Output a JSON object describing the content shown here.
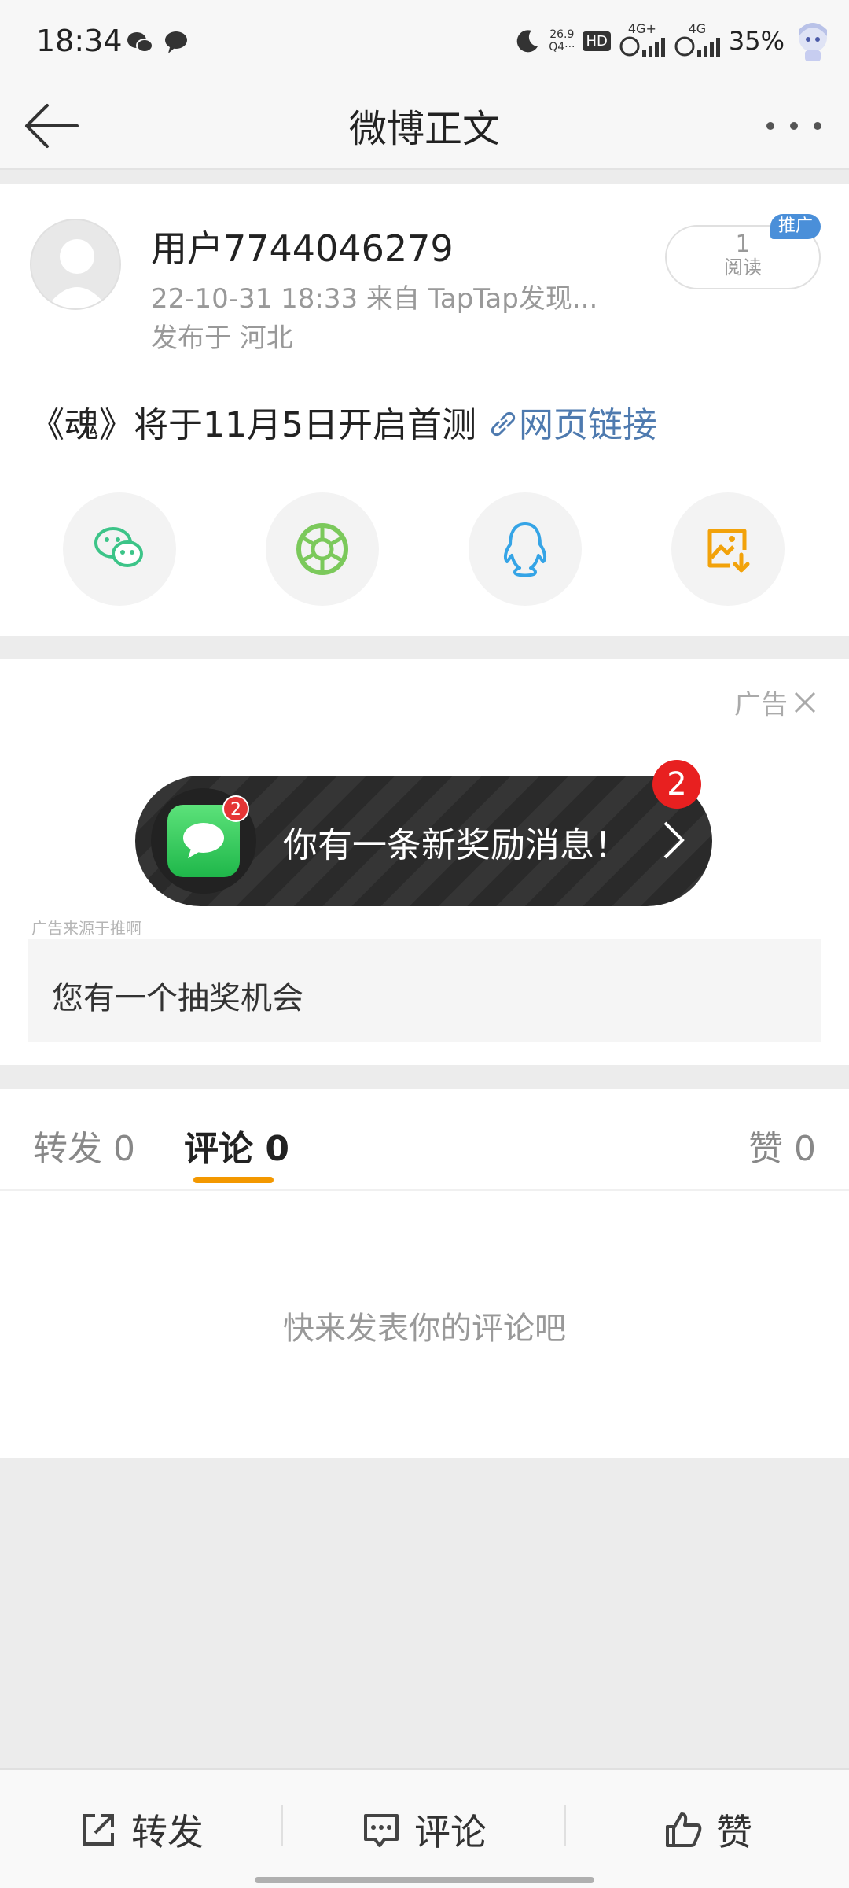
{
  "status_bar": {
    "time": "18:34",
    "speed_top": "26.9",
    "speed_bottom": "Q4···",
    "hd_label": "HD",
    "net1": "4G+",
    "net2": "4G",
    "battery": "35%"
  },
  "header": {
    "title": "微博正文"
  },
  "post": {
    "username": "用户7744046279",
    "meta": "22-10-31 18:33   来自 TapTap发现...",
    "location": "发布于 河北",
    "read_count": "1",
    "read_label": "阅读",
    "promo_badge": "推广",
    "text": "《魂》将于11月5日开启首测",
    "link_text": "网页链接"
  },
  "share_icons": [
    "wechat-icon",
    "moments-icon",
    "qq-icon",
    "save-image-icon"
  ],
  "ad": {
    "tag": "广告",
    "mini_badge": "2",
    "big_badge": "2",
    "message": "你有一条新奖励消息！",
    "source": "广告来源于推啊",
    "description": "您有一个抽奖机会"
  },
  "tabs": {
    "repost_label": "转发",
    "repost_count": "0",
    "comment_label": "评论",
    "comment_count": "0",
    "like_label": "赞",
    "like_count": "0"
  },
  "empty_hint": "快来发表你的评论吧",
  "bottom_bar": {
    "repost": "转发",
    "comment": "评论",
    "like": "赞"
  },
  "colors": {
    "accent_orange": "#f39800",
    "link_blue": "#4e7aaf",
    "wechat_green": "#3cc488",
    "moments_green": "#7bc95b",
    "qq_blue": "#35a4e6",
    "save_orange": "#f2a20a"
  }
}
